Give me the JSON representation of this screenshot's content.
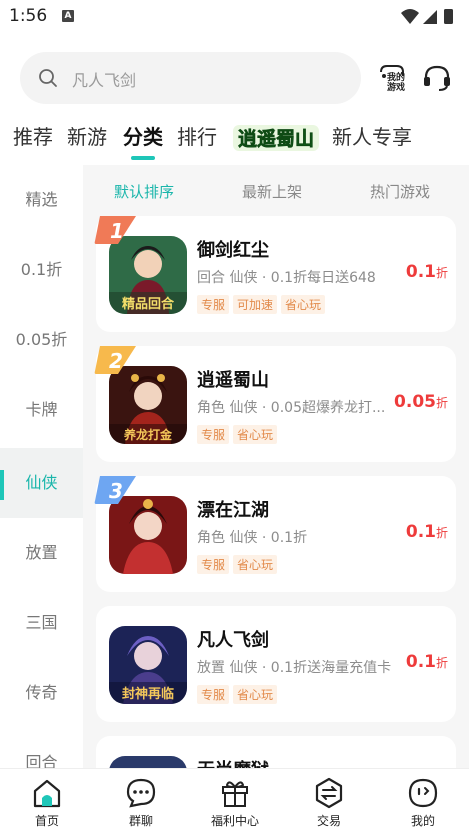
{
  "status": {
    "time": "1:56",
    "notif": "A"
  },
  "search": {
    "placeholder": "凡人飞剑",
    "mygame_label": "我的游戏"
  },
  "top_tabs": [
    {
      "label": "推荐"
    },
    {
      "label": "新游"
    },
    {
      "label": "分类"
    },
    {
      "label": "排行"
    },
    {
      "label": "逍遥蜀山"
    },
    {
      "label": "新人专享"
    }
  ],
  "sidebar": {
    "items": [
      {
        "label": "精选"
      },
      {
        "label": "0.1折"
      },
      {
        "label": "0.05折"
      },
      {
        "label": "卡牌"
      },
      {
        "label": "仙侠"
      },
      {
        "label": "放置"
      },
      {
        "label": "三国"
      },
      {
        "label": "传奇"
      },
      {
        "label": "回合"
      }
    ]
  },
  "sort_tabs": [
    {
      "label": "默认排序"
    },
    {
      "label": "最新上架"
    },
    {
      "label": "热门游戏"
    }
  ],
  "games": [
    {
      "rank": "1",
      "title": "御剑红尘",
      "desc": "回合 仙侠 · 0.1折每日送648",
      "tags": [
        "专服",
        "可加速",
        "省心玩"
      ],
      "discount": "0.1",
      "unit": "折",
      "icon_text": "精品回合"
    },
    {
      "rank": "2",
      "title": "逍遥蜀山",
      "desc": "角色 仙侠 · 0.05超爆养龙打...",
      "tags": [
        "专服",
        "省心玩"
      ],
      "discount": "0.05",
      "unit": "折",
      "icon_text": "养龙打金"
    },
    {
      "rank": "3",
      "title": "漂在江湖",
      "desc": "角色 仙侠 · 0.1折",
      "tags": [
        "专服",
        "省心玩"
      ],
      "discount": "0.1",
      "unit": "折",
      "icon_text": ""
    },
    {
      "rank": "",
      "title": "凡人飞剑",
      "desc": "放置 仙侠 · 0.1折送海量充值卡",
      "tags": [
        "专服",
        "省心玩"
      ],
      "discount": "0.1",
      "unit": "折",
      "icon_text": "封神再临"
    },
    {
      "rank": "",
      "title": "无尚魔狱",
      "desc": "",
      "tags": [],
      "discount": "",
      "unit": "",
      "icon_text": ""
    }
  ],
  "bottom_nav": [
    {
      "label": "首页",
      "icon": "home-icon"
    },
    {
      "label": "群聊",
      "icon": "chat-icon"
    },
    {
      "label": "福利中心",
      "icon": "gift-icon"
    },
    {
      "label": "交易",
      "icon": "trade-icon"
    },
    {
      "label": "我的",
      "icon": "profile-icon"
    }
  ],
  "colors": {
    "accent": "#1ec6b8",
    "discount": "#ee3b3b",
    "tag_text": "#e28a4a",
    "tag_bg": "#fdf1e6"
  }
}
